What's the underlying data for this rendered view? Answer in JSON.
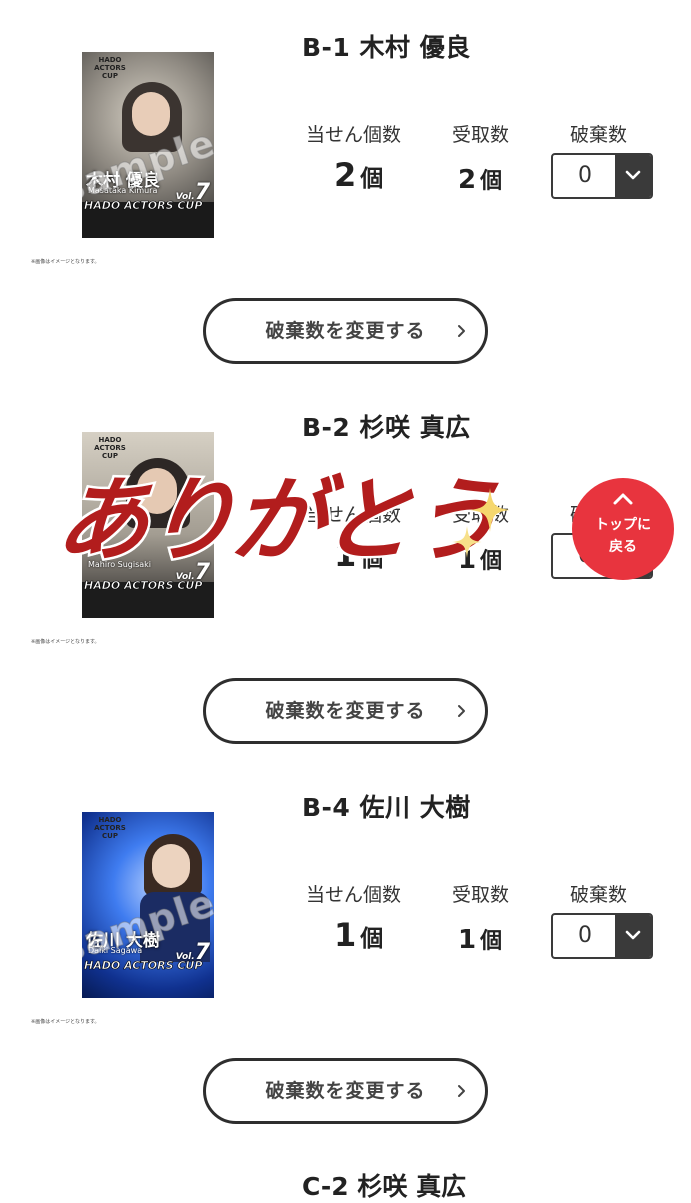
{
  "labels": {
    "won": "当せん個数",
    "received": "受取数",
    "discard": "破棄数",
    "unit": "個",
    "change_button": "破棄数を変更する",
    "poster_note": "※画像はイメージとなります。",
    "sample_watermark": "sample",
    "poster_series": "HADO ACTORS CUP",
    "poster_brand": "HADO ACTORS CUP",
    "poster_vol_prefix": "Vol.",
    "poster_vol_number": "7"
  },
  "items": [
    {
      "title": "B-1 木村 優良",
      "poster_name": "木村 優良",
      "poster_roman": "Masataka Kimura",
      "won": "2",
      "received": "2",
      "discard": "0"
    },
    {
      "title": "B-2 杉咲 真広",
      "poster_name": "杉咲 真広",
      "poster_roman": "Mahiro Sugisaki",
      "won": "1",
      "received": "1",
      "discard": "0"
    },
    {
      "title": "B-4 佐川 大樹",
      "poster_name": "佐川 大樹",
      "poster_roman": "Daiki Sagawa",
      "won": "1",
      "received": "1",
      "discard": "0"
    }
  ],
  "next_item_title": "C-2 杉咲 真広",
  "overlay": {
    "text": "ありがとう",
    "color": "#b21d1d"
  },
  "top_button": {
    "label": "トップに\n戻る",
    "color": "#e8343e"
  },
  "colors": {
    "poster1": "#cfc9bd",
    "poster2": "#c9c3b8",
    "poster3": "#1f4fd6"
  }
}
